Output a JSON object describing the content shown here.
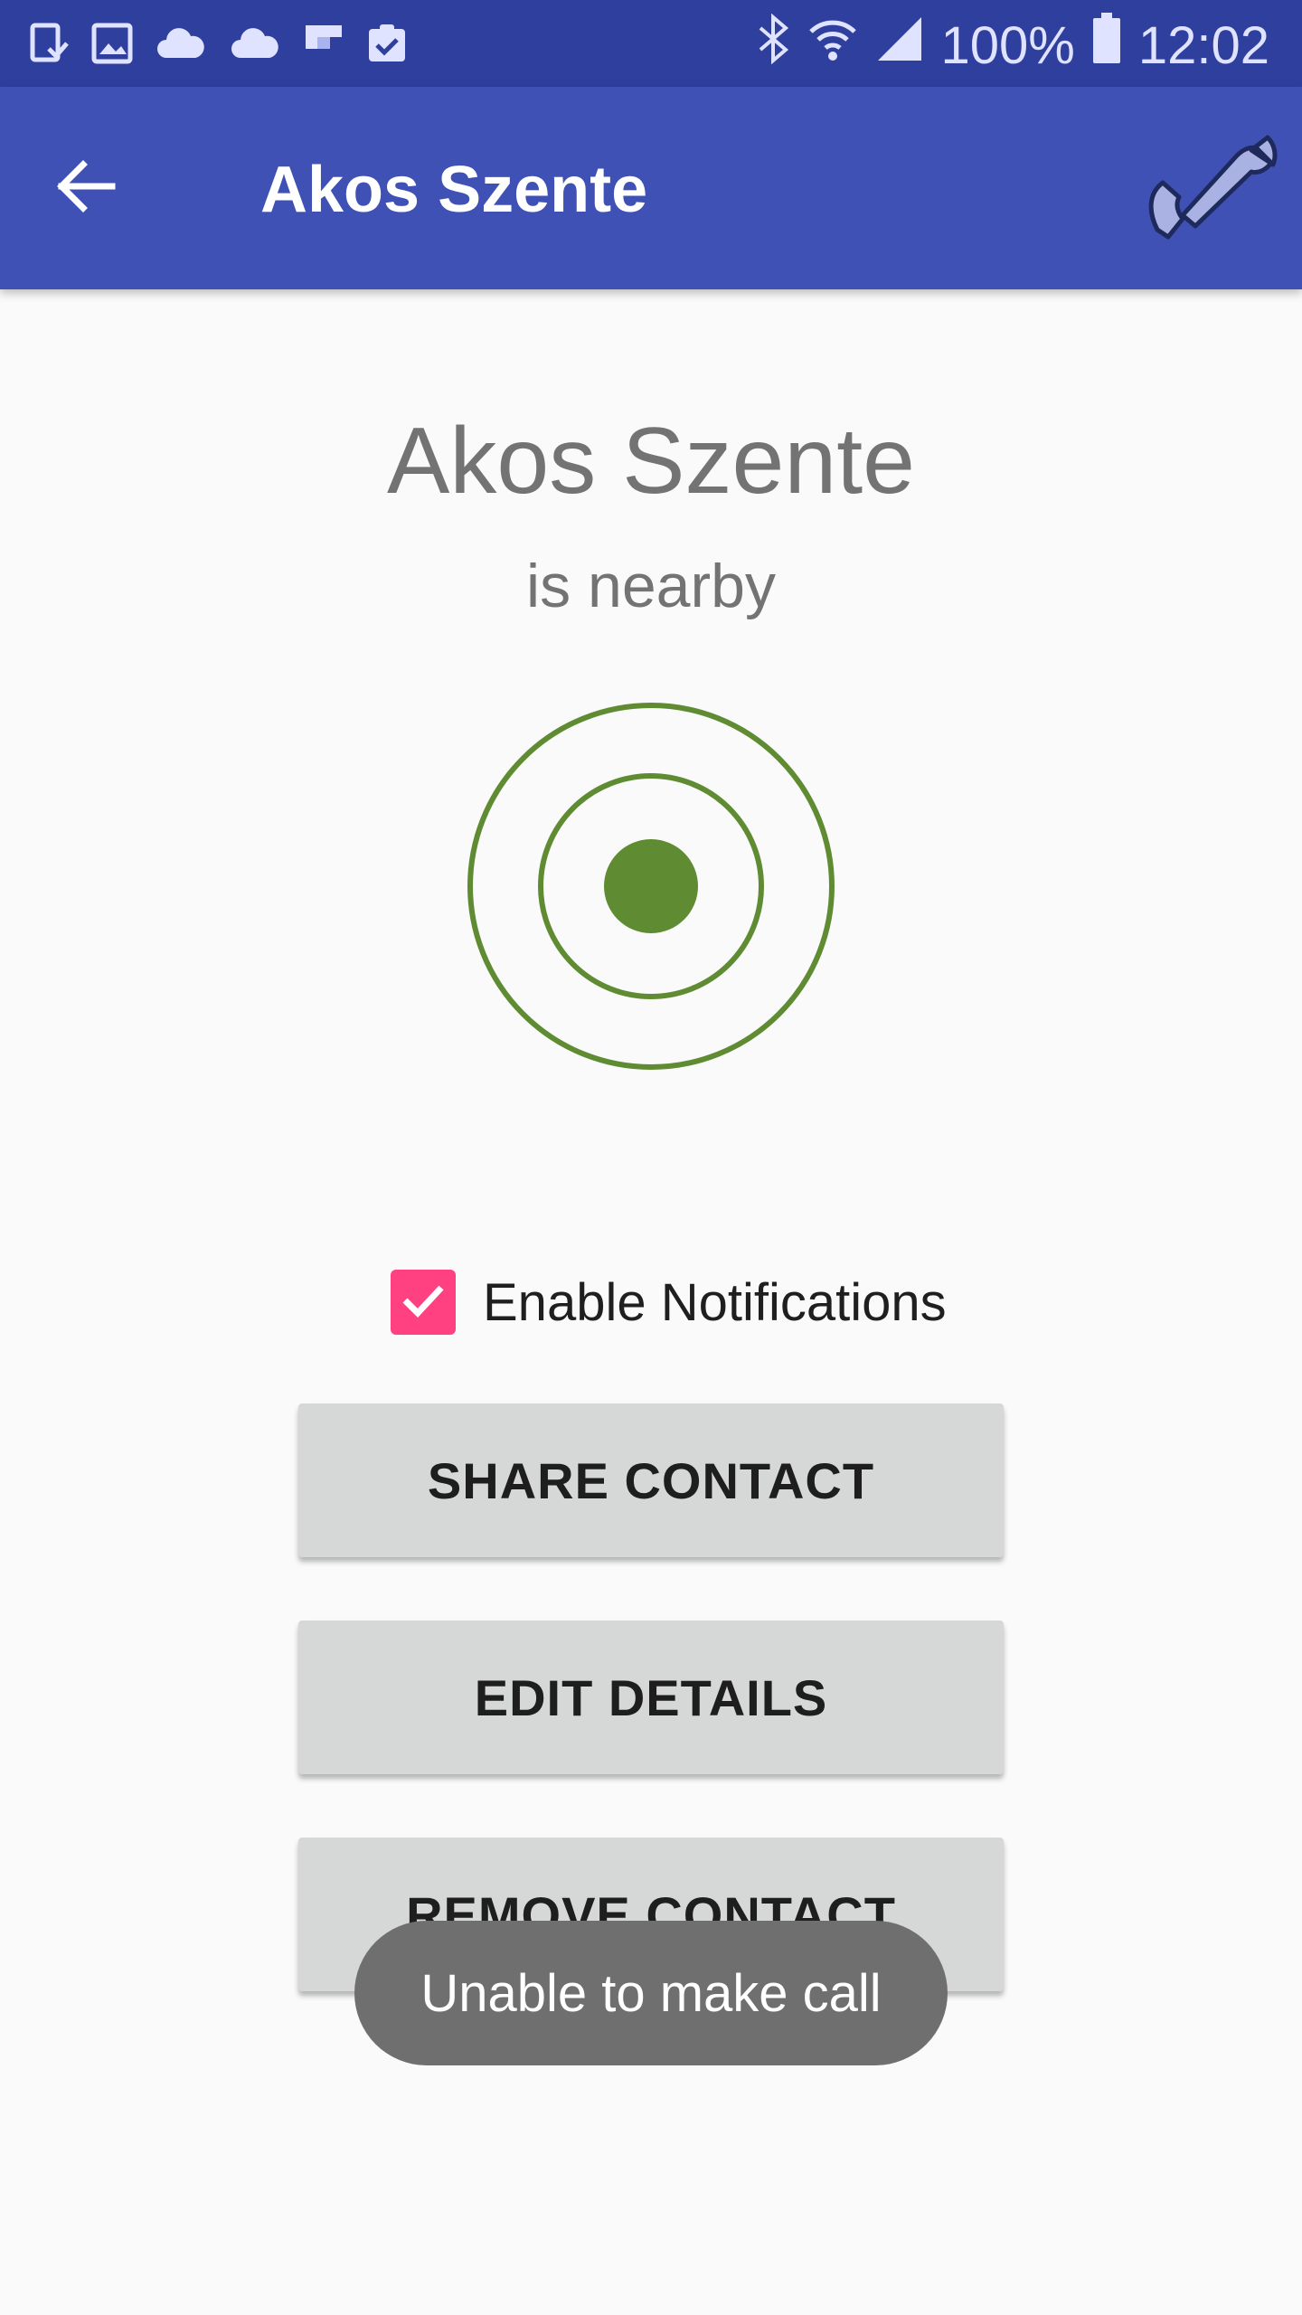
{
  "status_bar": {
    "notification_icons": [
      "device-download-icon",
      "image-icon",
      "cloud-icon",
      "cloud-icon",
      "flipboard-icon",
      "clipboard-check-icon"
    ],
    "bluetooth_icon": "bluetooth-icon",
    "wifi_icon": "wifi-icon",
    "signal_icon": "signal-icon",
    "battery_percent": "100%",
    "battery_icon": "battery-icon",
    "time": "12:02"
  },
  "app_bar": {
    "back_icon": "arrow-back-icon",
    "title": "Akos Szente",
    "call_icon": "phone-icon"
  },
  "contact": {
    "name": "Akos Szente",
    "status": "is nearby"
  },
  "proximity_icon": "radar-target-icon",
  "notifications": {
    "label": "Enable Notifications",
    "checked": true
  },
  "buttons": {
    "share": "SHARE CONTACT",
    "edit": "EDIT DETAILS",
    "remove": "REMOVE CONTACT"
  },
  "toast": {
    "message": "Unable to make call"
  },
  "colors": {
    "primary": "#3f51b5",
    "primary_dark": "#2f3f9e",
    "accent": "#ff4081",
    "proximity_green": "#5f8b32",
    "toast_background": "#6f6f6f"
  }
}
